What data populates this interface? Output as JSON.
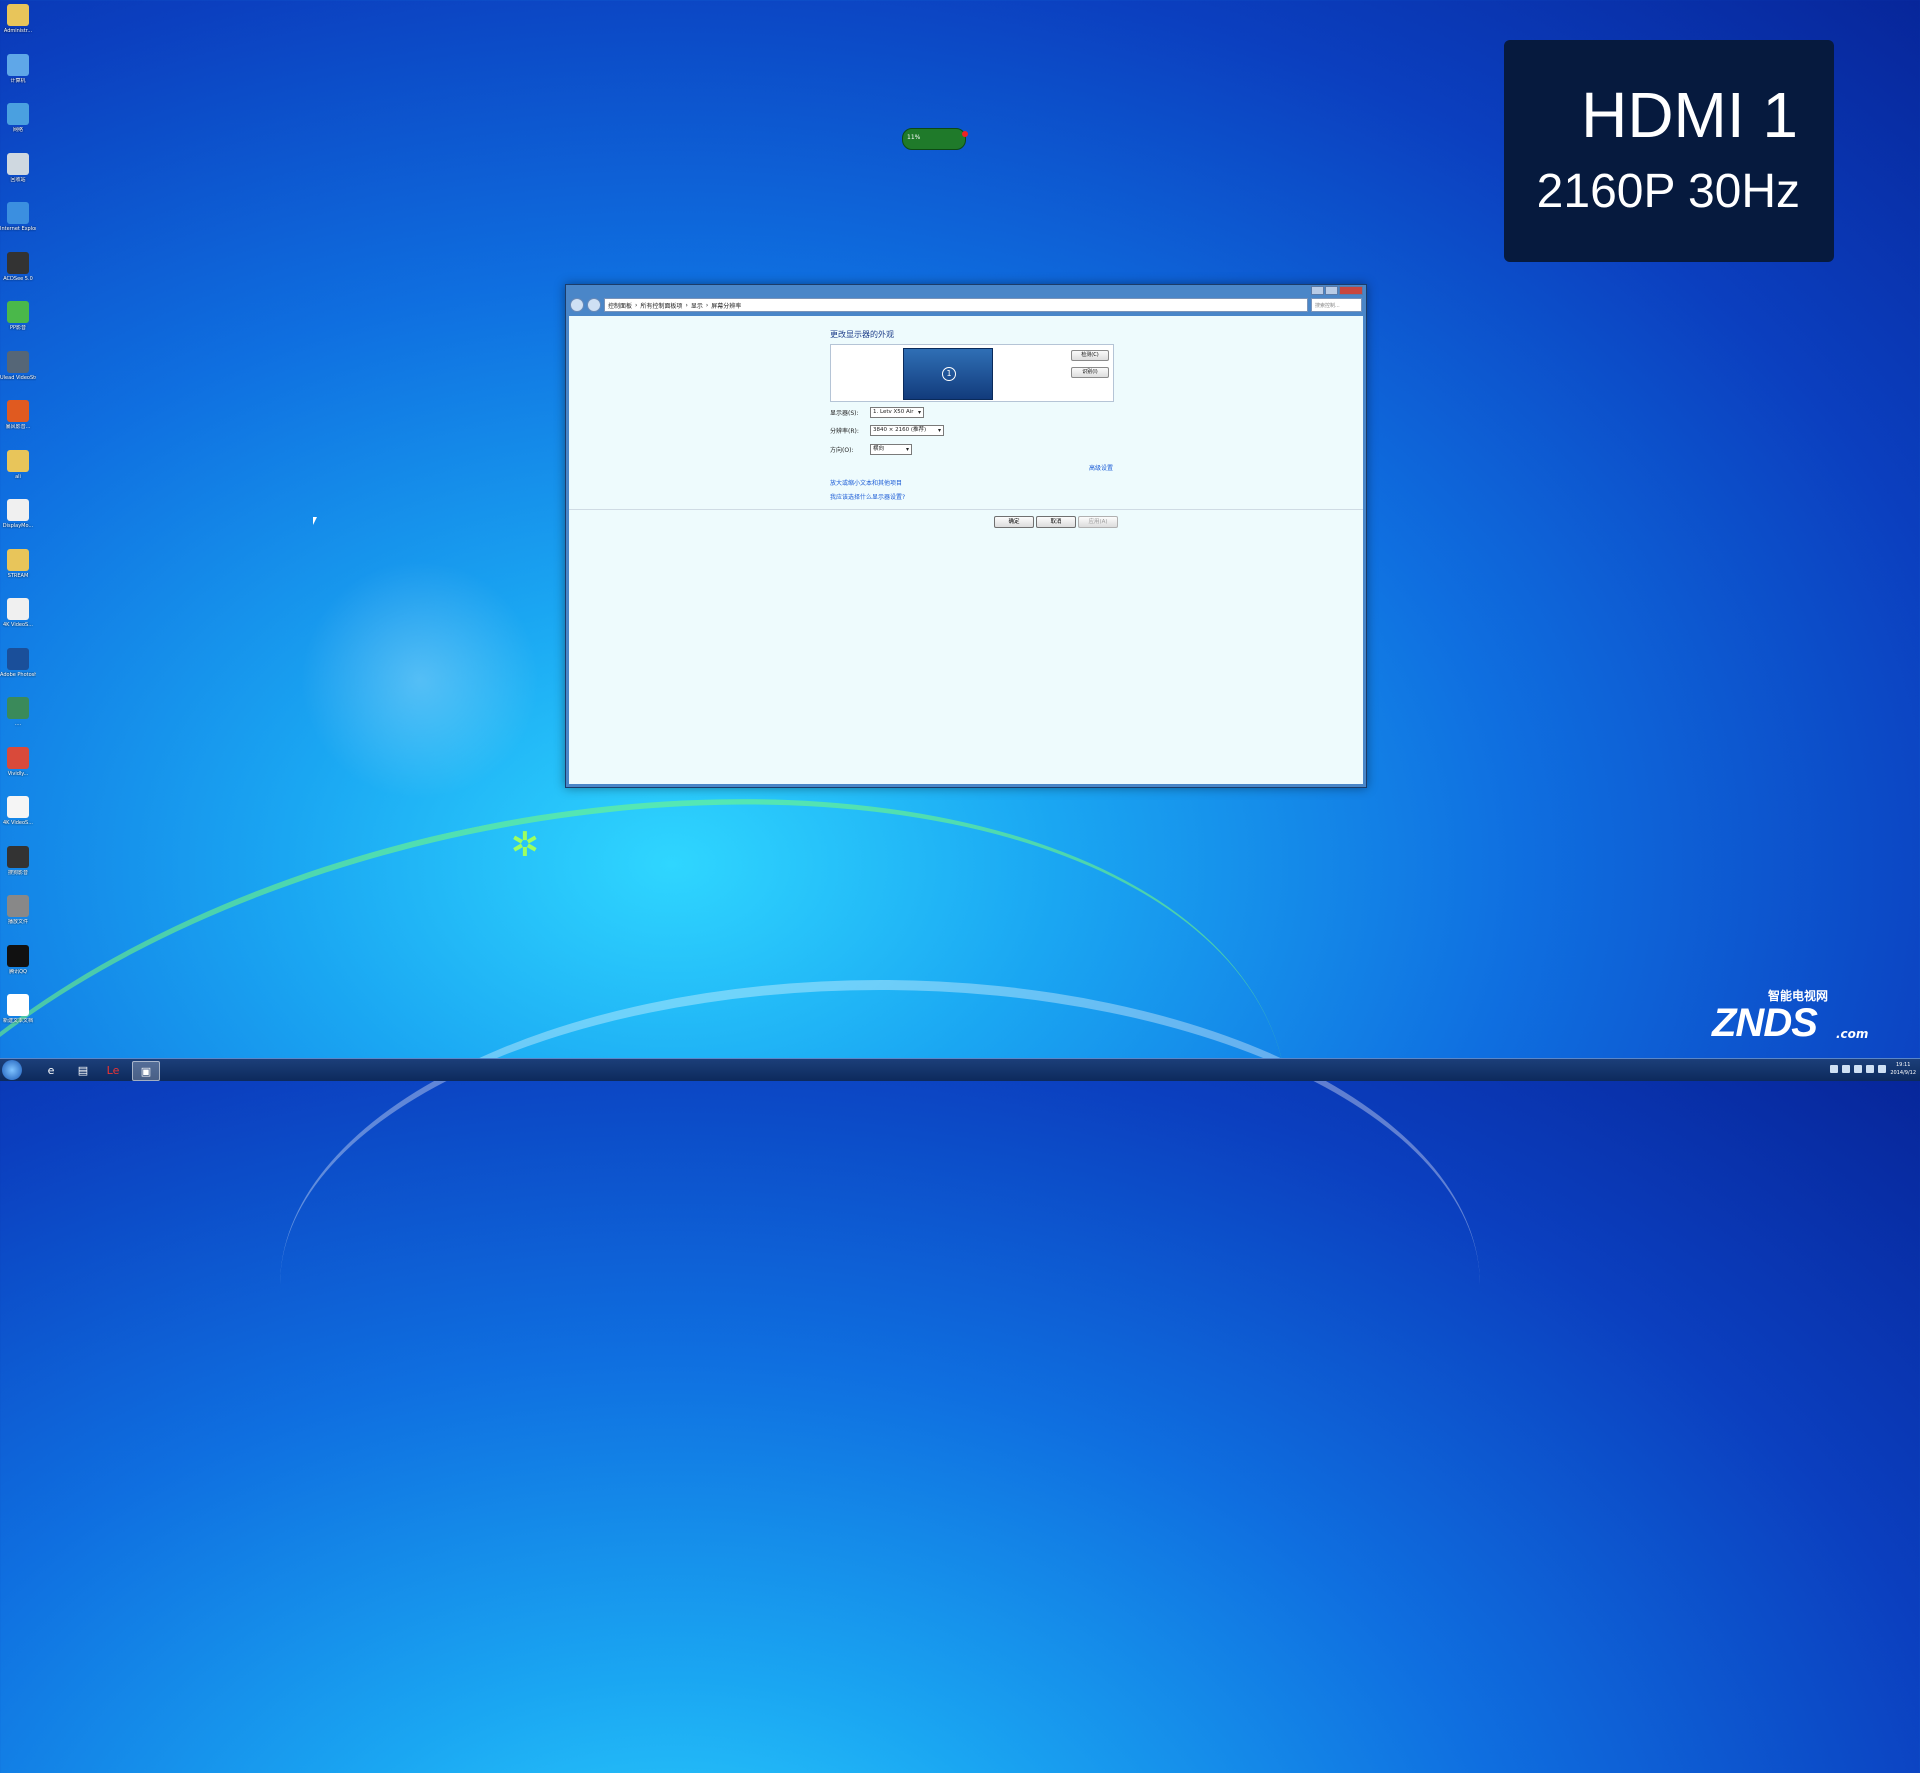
{
  "desktop": {
    "icons": [
      {
        "label": "Administr...",
        "icon": "folder-user-icon",
        "color": "#e8c55a"
      },
      {
        "label": "计算机",
        "icon": "computer-icon",
        "color": "#5fa7e8"
      },
      {
        "label": "网络",
        "icon": "network-icon",
        "color": "#4aa0e0"
      },
      {
        "label": "回收站",
        "icon": "recycle-bin-icon",
        "color": "#cfd8e0"
      },
      {
        "label": "Internet Explorer",
        "icon": "ie-icon",
        "color": "#3b8fe0"
      },
      {
        "label": "ACDSee 5.0",
        "icon": "acdsee-icon",
        "color": "#333333"
      },
      {
        "label": "PP影音",
        "icon": "pp-player-icon",
        "color": "#4ab84a"
      },
      {
        "label": "Ulead VideoStu...",
        "icon": "ulead-icon",
        "color": "#556677"
      },
      {
        "label": "暴风影音...",
        "icon": "storm-player-icon",
        "color": "#e05a20"
      },
      {
        "label": "ali",
        "icon": "folder-icon",
        "color": "#e8c55a"
      },
      {
        "label": "DisplayMo...",
        "icon": "file-icon",
        "color": "#f0f0f0"
      },
      {
        "label": "STREAM",
        "icon": "folder-icon",
        "color": "#e8c55a"
      },
      {
        "label": "4K VideoS...",
        "icon": "file-icon",
        "color": "#f0f0f0"
      },
      {
        "label": "Adobe Photosh...",
        "icon": "photoshop-icon",
        "color": "#1a4f9a"
      },
      {
        "label": "....",
        "icon": "app-icon",
        "color": "#3a8a5a"
      },
      {
        "label": "Vividly...",
        "icon": "image-app-icon",
        "color": "#d94a3a"
      },
      {
        "label": "4K VideoS...",
        "icon": "file-icon",
        "color": "#f5f5f5"
      },
      {
        "label": "搜狗影音",
        "icon": "media-icon",
        "color": "#333333"
      },
      {
        "label": "播放文件",
        "icon": "film-icon",
        "color": "#888888"
      },
      {
        "label": "腾讯QQ",
        "icon": "qq-icon",
        "color": "#111111"
      },
      {
        "label": "新建文本文档",
        "icon": "text-file-icon",
        "color": "#ffffff"
      }
    ]
  },
  "osd": {
    "line1": "HDMI 1",
    "line2": "2160P 30Hz"
  },
  "gadget": {
    "percent": "11%"
  },
  "window": {
    "breadcrumb": [
      "控制面板",
      "所有控制面板项",
      "显示",
      "屏幕分辨率"
    ],
    "search_placeholder": "搜索控制...",
    "heading": "更改显示器的外观",
    "monitor_number": "1",
    "detect_label": "检测(C)",
    "identify_label": "识别(I)",
    "display_label": "显示器(S):",
    "display_value": "1. Letv X50 Air",
    "resolution_label": "分辨率(R):",
    "resolution_value": "3840 × 2160 (推荐)",
    "orientation_label": "方向(O):",
    "orientation_value": "横向",
    "advanced_link": "高级设置",
    "link1": "放大或缩小文本和其他项目",
    "link2": "我应该选择什么显示器设置?",
    "ok_label": "确定",
    "cancel_label": "取消",
    "apply_label": "应用(A)"
  },
  "taskbar": {
    "clock_time": "19:11",
    "clock_date": "2014/9/12"
  },
  "watermark": {
    "brand": "ZNDS",
    "cn": "智能电视网",
    "suffix": ".com"
  }
}
